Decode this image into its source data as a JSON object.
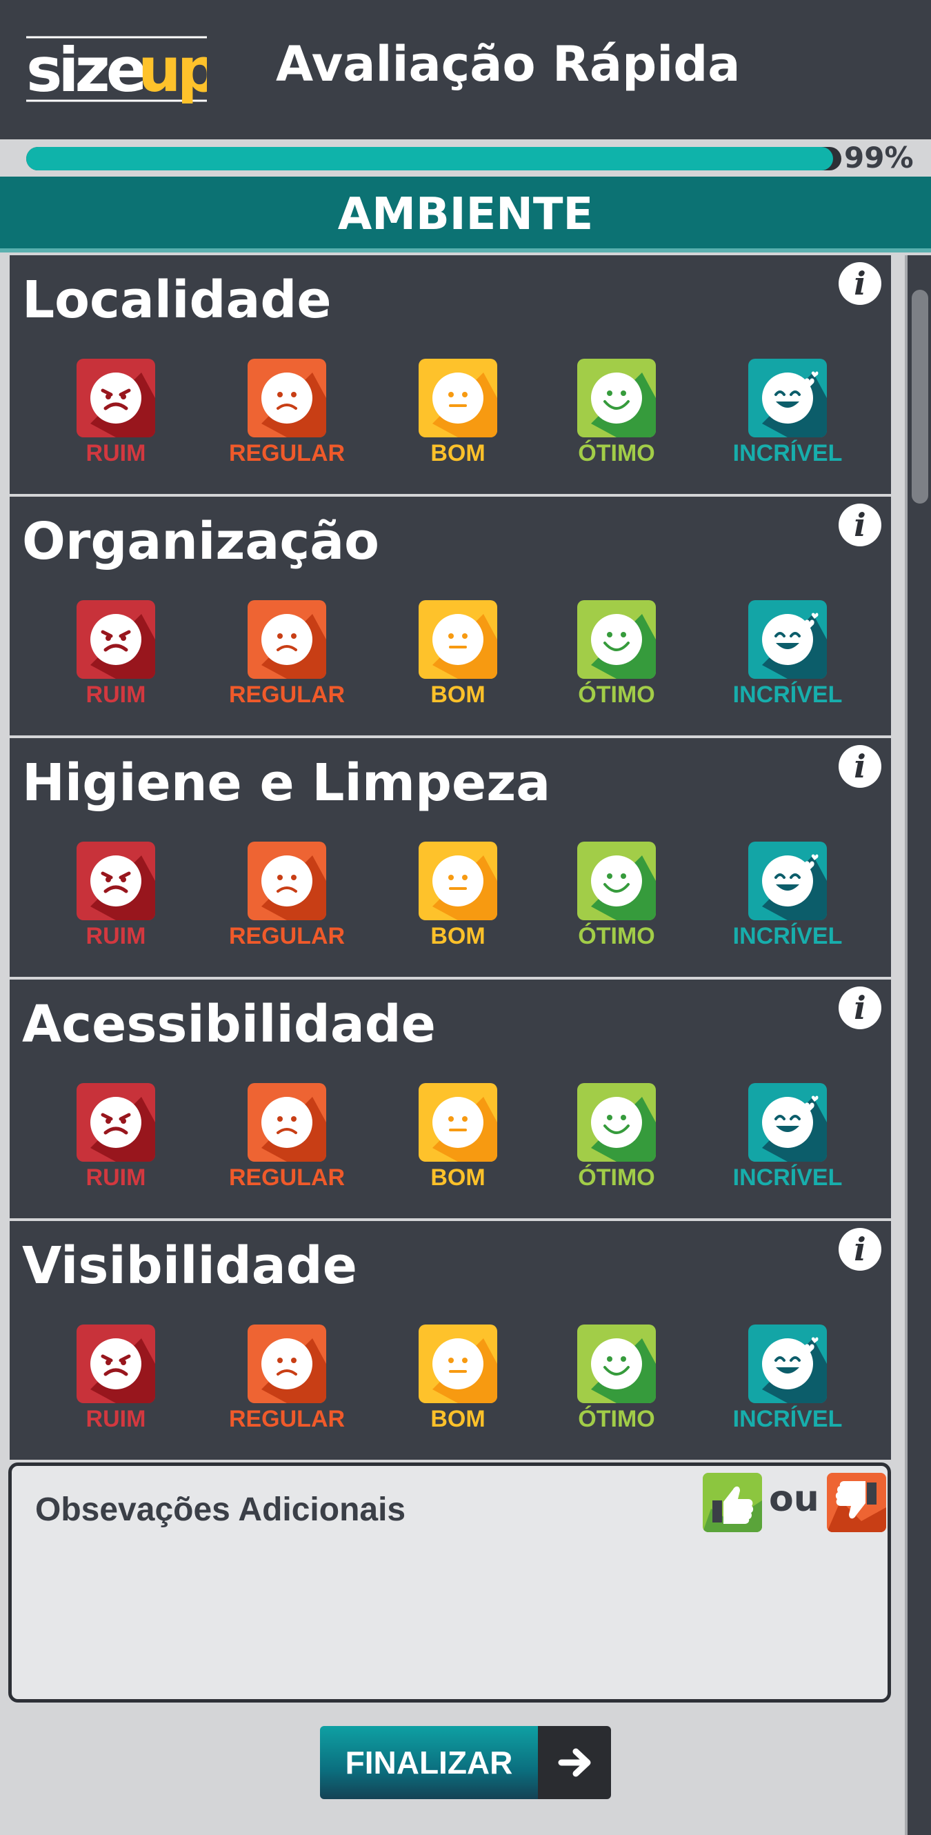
{
  "header": {
    "logo_text": "sizeup",
    "title": "Avaliação Rápida"
  },
  "progress": {
    "value": 0.99,
    "label": "99%"
  },
  "section": {
    "title": "AMBIENTE"
  },
  "rating_options": [
    {
      "label": "RUIM",
      "icon": "angry-face-icon",
      "color": "#c8323a",
      "dark": "#98161d",
      "text_color": "#d3383f"
    },
    {
      "label": "REGULAR",
      "icon": "sad-face-icon",
      "color": "#ee6433",
      "dark": "#c83e15",
      "text_color": "#f05a2a"
    },
    {
      "label": "BOM",
      "icon": "neutral-face-icon",
      "color": "#fec22b",
      "dark": "#f79a11",
      "text_color": "#fdc12a"
    },
    {
      "label": "ÓTIMO",
      "icon": "smile-face-icon",
      "color": "#a2cd48",
      "dark": "#369b3c",
      "text_color": "#a2cd48"
    },
    {
      "label": "INCRÍVEL",
      "icon": "love-face-icon",
      "color": "#13a5a6",
      "dark": "#0c5d6a",
      "text_color": "#17aeac"
    }
  ],
  "categories": [
    {
      "title": "Localidade"
    },
    {
      "title": "Organização"
    },
    {
      "title": "Higiene e Limpeza"
    },
    {
      "title": "Acessibilidade"
    },
    {
      "title": "Visibilidade"
    }
  ],
  "observations": {
    "label": "Obsevações Adicionais",
    "separator": "ou",
    "thumb_up_color": "#8cc63f",
    "thumb_down_color": "#ee6433"
  },
  "finalize": {
    "label": "FINALIZAR"
  }
}
